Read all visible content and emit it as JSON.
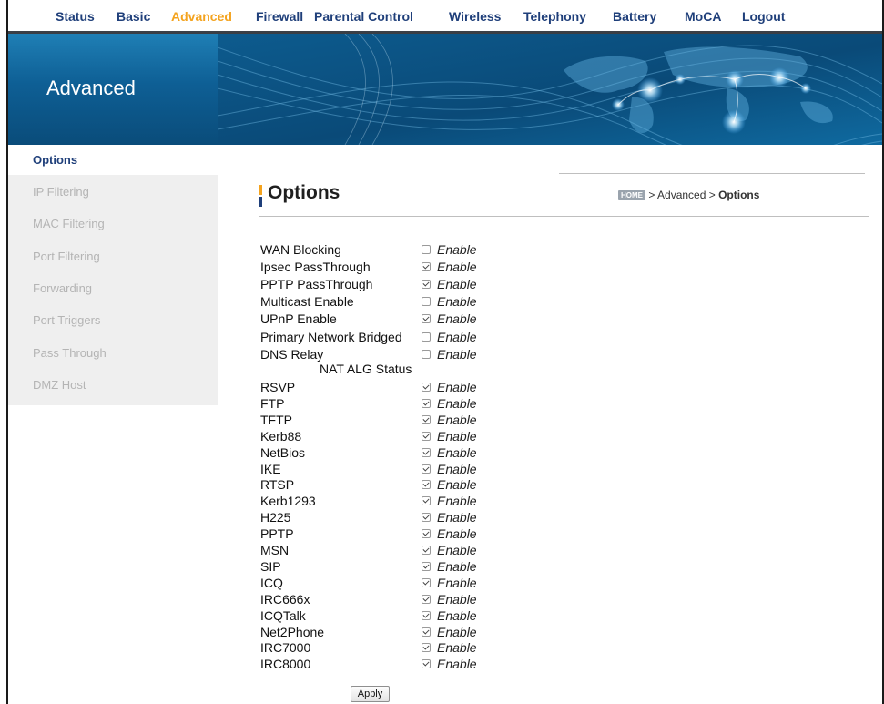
{
  "topnav": {
    "items": [
      "Status",
      "Basic",
      "Advanced",
      "Firewall",
      "Parental Control",
      "Wireless",
      "Telephony",
      "Battery",
      "MoCA",
      "Logout"
    ],
    "active": "Advanced"
  },
  "banner": {
    "title": "Advanced"
  },
  "sidebar": {
    "items": [
      "Options",
      "IP Filtering",
      "MAC Filtering",
      "Port Filtering",
      "Forwarding",
      "Port Triggers",
      "Pass Through",
      "DMZ Host"
    ],
    "active": "Options"
  },
  "page": {
    "title": "Options",
    "breadcrumb": {
      "home": "HOME",
      "sep1": " > ",
      "section": "Advanced",
      "sep2": " > ",
      "current": "Options"
    }
  },
  "options": {
    "enable_label": "Enable",
    "general": [
      {
        "label": "WAN Blocking",
        "checked": false
      },
      {
        "label": "Ipsec PassThrough",
        "checked": true
      },
      {
        "label": "PPTP PassThrough",
        "checked": true
      },
      {
        "label": "Multicast Enable",
        "checked": false
      },
      {
        "label": "UPnP Enable",
        "checked": true
      },
      {
        "label": "Primary Network Bridged",
        "checked": false
      },
      {
        "label": "DNS Relay",
        "checked": false
      }
    ],
    "nat_heading": "NAT ALG Status",
    "nat_alg": [
      {
        "label": "RSVP",
        "checked": true
      },
      {
        "label": "FTP",
        "checked": true
      },
      {
        "label": "TFTP",
        "checked": true
      },
      {
        "label": "Kerb88",
        "checked": true
      },
      {
        "label": "NetBios",
        "checked": true
      },
      {
        "label": "IKE",
        "checked": true
      },
      {
        "label": "RTSP",
        "checked": true
      },
      {
        "label": "Kerb1293",
        "checked": true
      },
      {
        "label": "H225",
        "checked": true
      },
      {
        "label": "PPTP",
        "checked": true
      },
      {
        "label": "MSN",
        "checked": true
      },
      {
        "label": "SIP",
        "checked": true
      },
      {
        "label": "ICQ",
        "checked": true
      },
      {
        "label": "IRC666x",
        "checked": true
      },
      {
        "label": "ICQTalk",
        "checked": true
      },
      {
        "label": "Net2Phone",
        "checked": true
      },
      {
        "label": "IRC7000",
        "checked": true
      },
      {
        "label": "IRC8000",
        "checked": true
      }
    ],
    "apply_label": "Apply"
  },
  "colors": {
    "nav_text": "#1f3f7a",
    "nav_active": "#f4a31e",
    "banner_blue": "#0b4d7c",
    "sidebar_bg": "#efefef"
  }
}
